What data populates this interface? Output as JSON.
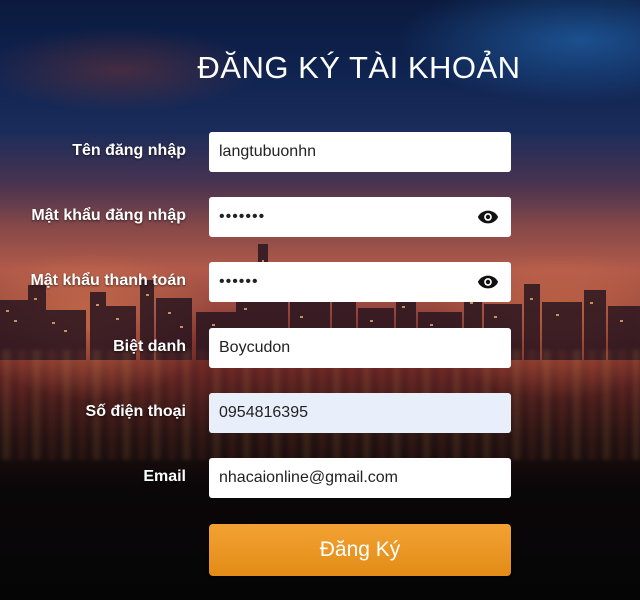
{
  "page_title": "ĐĂNG KÝ TÀI KHOẢN",
  "fields": {
    "username": {
      "label": "Tên đăng nhập",
      "value": "langtubuonhn"
    },
    "login_password": {
      "label": "Mật khẩu đăng nhập",
      "value": "•••••••",
      "icon": "eye-icon"
    },
    "payment_password": {
      "label": "Mật khẩu thanh toán",
      "value": "••••••",
      "icon": "eye-icon"
    },
    "nickname": {
      "label": "Biệt danh",
      "value": "Boycudon"
    },
    "phone": {
      "label": "Số điện thoại",
      "value": "0954816395"
    },
    "email": {
      "label": "Email",
      "value": "nhacaionline@gmail.com"
    }
  },
  "submit_label": "Đăng Ký",
  "colors": {
    "button": "#e8931f",
    "highlight_field": "#e8effb",
    "text": "#ffffff"
  }
}
